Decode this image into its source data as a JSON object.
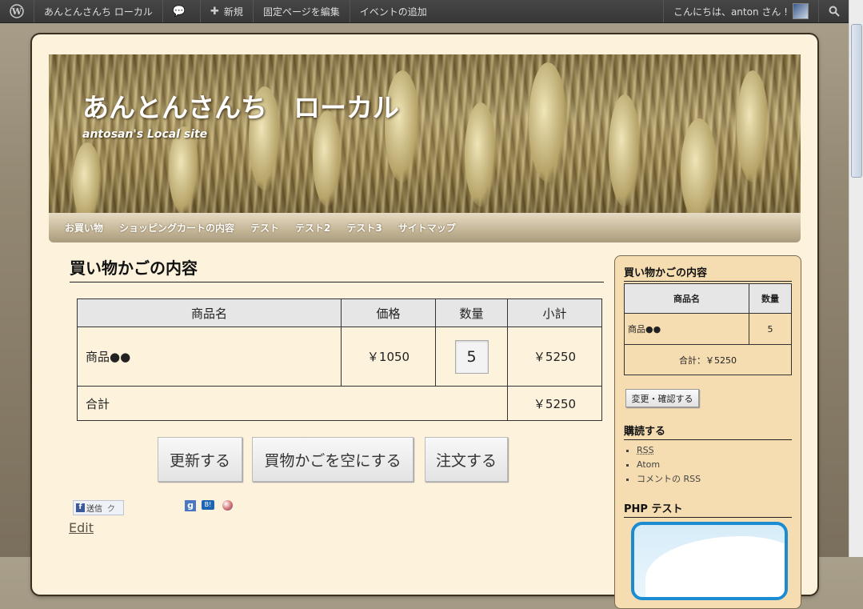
{
  "adminbar": {
    "site_name": "あんとんさんち ローカル",
    "new_label": "新規",
    "edit_page_label": "固定ページを編集",
    "add_event_label": "イベントの追加",
    "greeting": "こんにちは、anton さん !"
  },
  "site": {
    "title": "あんとんさんち　ローカル",
    "description": "antosan's Local site"
  },
  "nav": {
    "items": [
      "お買い物",
      "ショッピングカートの内容",
      "テスト",
      "テスト2",
      "テスト3",
      "サイトマップ"
    ]
  },
  "main": {
    "title": "買い物かごの内容",
    "table": {
      "headers": [
        "商品名",
        "価格",
        "数量",
        "小計"
      ],
      "row": {
        "name": "商品●●",
        "price": "￥1050",
        "qty": "5",
        "subtotal": "￥5250"
      },
      "total_label": "合計",
      "total_value": "￥5250"
    },
    "buttons": {
      "update": "更新する",
      "empty": "買物かごを空にする",
      "order": "注文する"
    },
    "share": {
      "facebook": "送信",
      "facebook_tail": "ク",
      "google": "g",
      "hatena": "B!"
    },
    "edit_link": "Edit"
  },
  "sidebar": {
    "cart_title": "買い物かごの内容",
    "cart_headers": [
      "商品名",
      "数量"
    ],
    "cart_row": {
      "name": "商品●●",
      "qty": "5"
    },
    "cart_total": "合計：￥5250",
    "change_button": "変更・確認する",
    "subscribe_title": "購読する",
    "subscribe_items": [
      "RSS",
      "Atom",
      "コメントの RSS"
    ],
    "php_title": "PHP テスト"
  }
}
